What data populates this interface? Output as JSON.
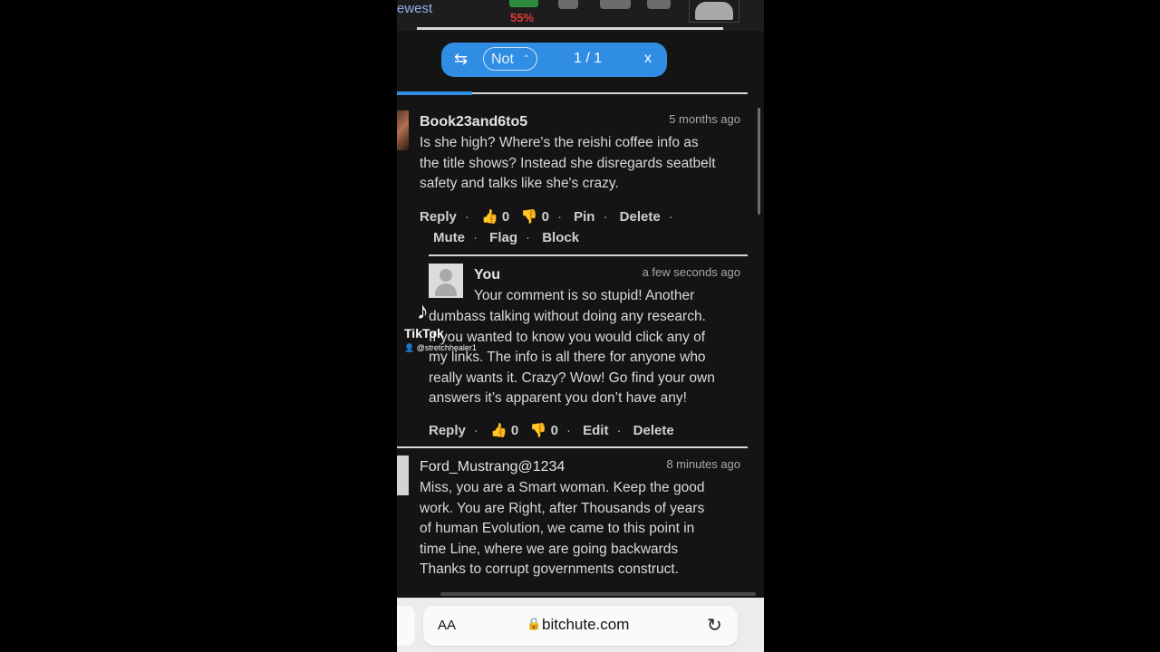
{
  "status_bar": {
    "battery_percent": "55%",
    "battery_color": "#e23a3a"
  },
  "find_bar": {
    "search_term": "Not",
    "match_count": "1 / 1",
    "close_label": "x",
    "prev_next_icon": "arrows-icon"
  },
  "tabs": {
    "active_partial_label": "ewest"
  },
  "comments": [
    {
      "author": "Book23and6to5",
      "time": "5 months ago",
      "lines": [
        "Is she high? Where's the reishi coffee info as",
        "the title shows? Instead she disregards seatbelt",
        "safety and talks like she's crazy."
      ],
      "actions": {
        "reply": "Reply",
        "likes": "0",
        "dislikes": "0",
        "pin": "Pin",
        "delete": "Delete",
        "mute": "Mute",
        "flag": "Flag",
        "block": "Block"
      }
    },
    {
      "author": "You",
      "time": "a few seconds ago",
      "lines": [
        "Your comment is so stupid! Another",
        "dumbass talking without doing any research.",
        "If you wanted to know you would click any of",
        "my links. The info is all there for anyone who",
        "really wants it. Crazy? Wow! Go find your own",
        "answers it’s apparent you don’t have any!"
      ],
      "actions": {
        "reply": "Reply",
        "likes": "0",
        "dislikes": "0",
        "edit": "Edit",
        "delete": "Delete"
      }
    },
    {
      "author": "Ford_Mustrang@1234",
      "time": "8 minutes ago",
      "lines": [
        "Miss, you are a Smart woman. Keep the good",
        "work. You are Right, after Thousands of years",
        "of human Evolution, we came to this point in",
        "time Line, where we are going backwards",
        "Thanks to corrupt governments construct."
      ]
    }
  ],
  "watermark": {
    "brand": "TikTok",
    "user": "@stretchhealer1"
  },
  "browser": {
    "text_size_label": "AA",
    "url": "bitchute.com"
  },
  "colors": {
    "accent": "#2f8de4",
    "background": "#141414"
  }
}
